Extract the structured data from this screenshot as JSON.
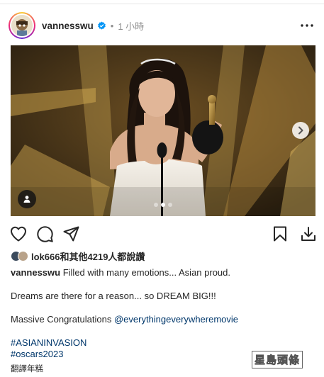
{
  "post": {
    "username": "vannesswu",
    "separator": "•",
    "time_ago": "1 小時",
    "verified": true
  },
  "icons": {
    "more": "more-options-icon",
    "like": "heart-outline-icon",
    "comment": "comment-bubble-icon",
    "share": "paper-plane-icon",
    "save": "bookmark-icon",
    "download": "download-icon",
    "next": "chevron-right-icon",
    "tag": "person-tag-icon"
  },
  "carousel": {
    "slides": 3,
    "active": 1
  },
  "likes": {
    "user": "lok666",
    "connector": "和其他",
    "count": "4219",
    "suffix": "人都說讚"
  },
  "caption": {
    "username": "vannesswu",
    "line1": "Filled with many emotions... Asian proud.",
    "line2": "Dreams are there for a reason... so DREAM BIG!!!",
    "line3_prefix": "Massive Congratulations ",
    "mention": "@everythingeverywheremovie"
  },
  "hashtags": [
    "#ASIANINVASION",
    "#oscars2023"
  ],
  "translate_label": "翻譯年糕",
  "watermark": "星島頭條",
  "colors": {
    "link": "#00376b",
    "text": "#262626",
    "muted": "#8e8e8e",
    "verified": "#0095f6"
  }
}
